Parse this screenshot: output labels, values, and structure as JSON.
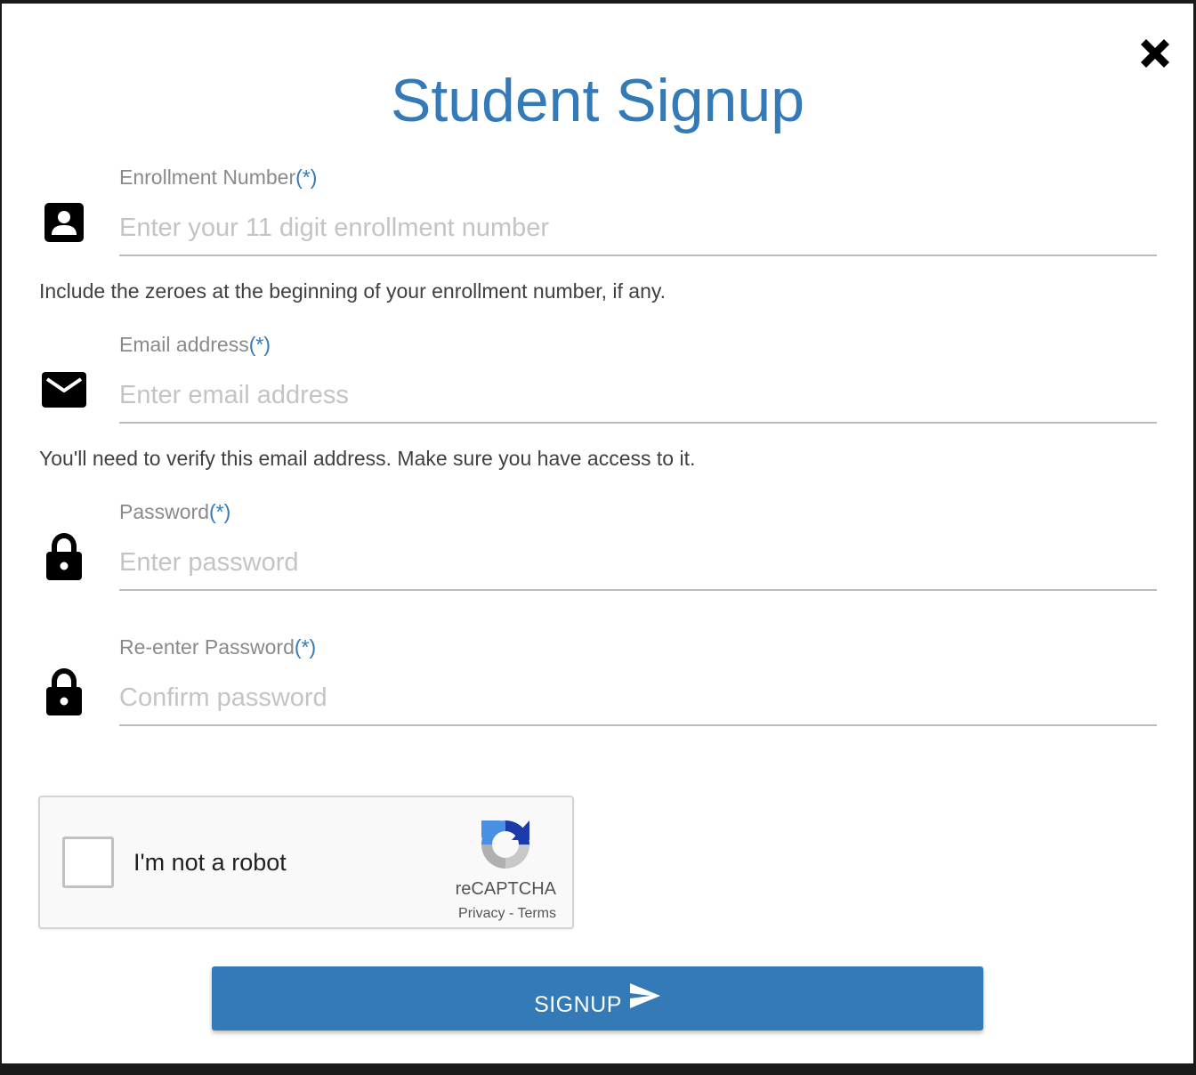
{
  "modal": {
    "title": "Student Signup",
    "close_icon": "close-x-icon"
  },
  "fields": [
    {
      "label": "Enrollment Number",
      "required_marker": "(*)",
      "placeholder": "Enter your 11 digit enrollment number",
      "value": "",
      "icon": "account-box-icon",
      "help": "Include the zeroes at the beginning of your enrollment number, if any."
    },
    {
      "label": "Email address",
      "required_marker": "(*)",
      "placeholder": "Enter email address",
      "value": "",
      "icon": "email-icon",
      "help": "You'll need to verify this email address. Make sure you have access to it."
    },
    {
      "label": "Password",
      "required_marker": "(*)",
      "placeholder": "Enter password",
      "value": "",
      "icon": "lock-icon"
    },
    {
      "label": "Re-enter Password",
      "required_marker": "(*)",
      "placeholder": "Confirm password",
      "value": "",
      "icon": "lock-icon"
    }
  ],
  "captcha": {
    "label": "I'm not a robot",
    "brand": "reCAPTCHA",
    "privacy": "Privacy",
    "separator": " - ",
    "terms": "Terms",
    "checked": false
  },
  "signup": {
    "label": "SIGNUP",
    "icon": "send-icon"
  },
  "colors": {
    "accent": "#337ab7",
    "label": "#8a8a8a",
    "placeholder": "#c4c4c4"
  }
}
